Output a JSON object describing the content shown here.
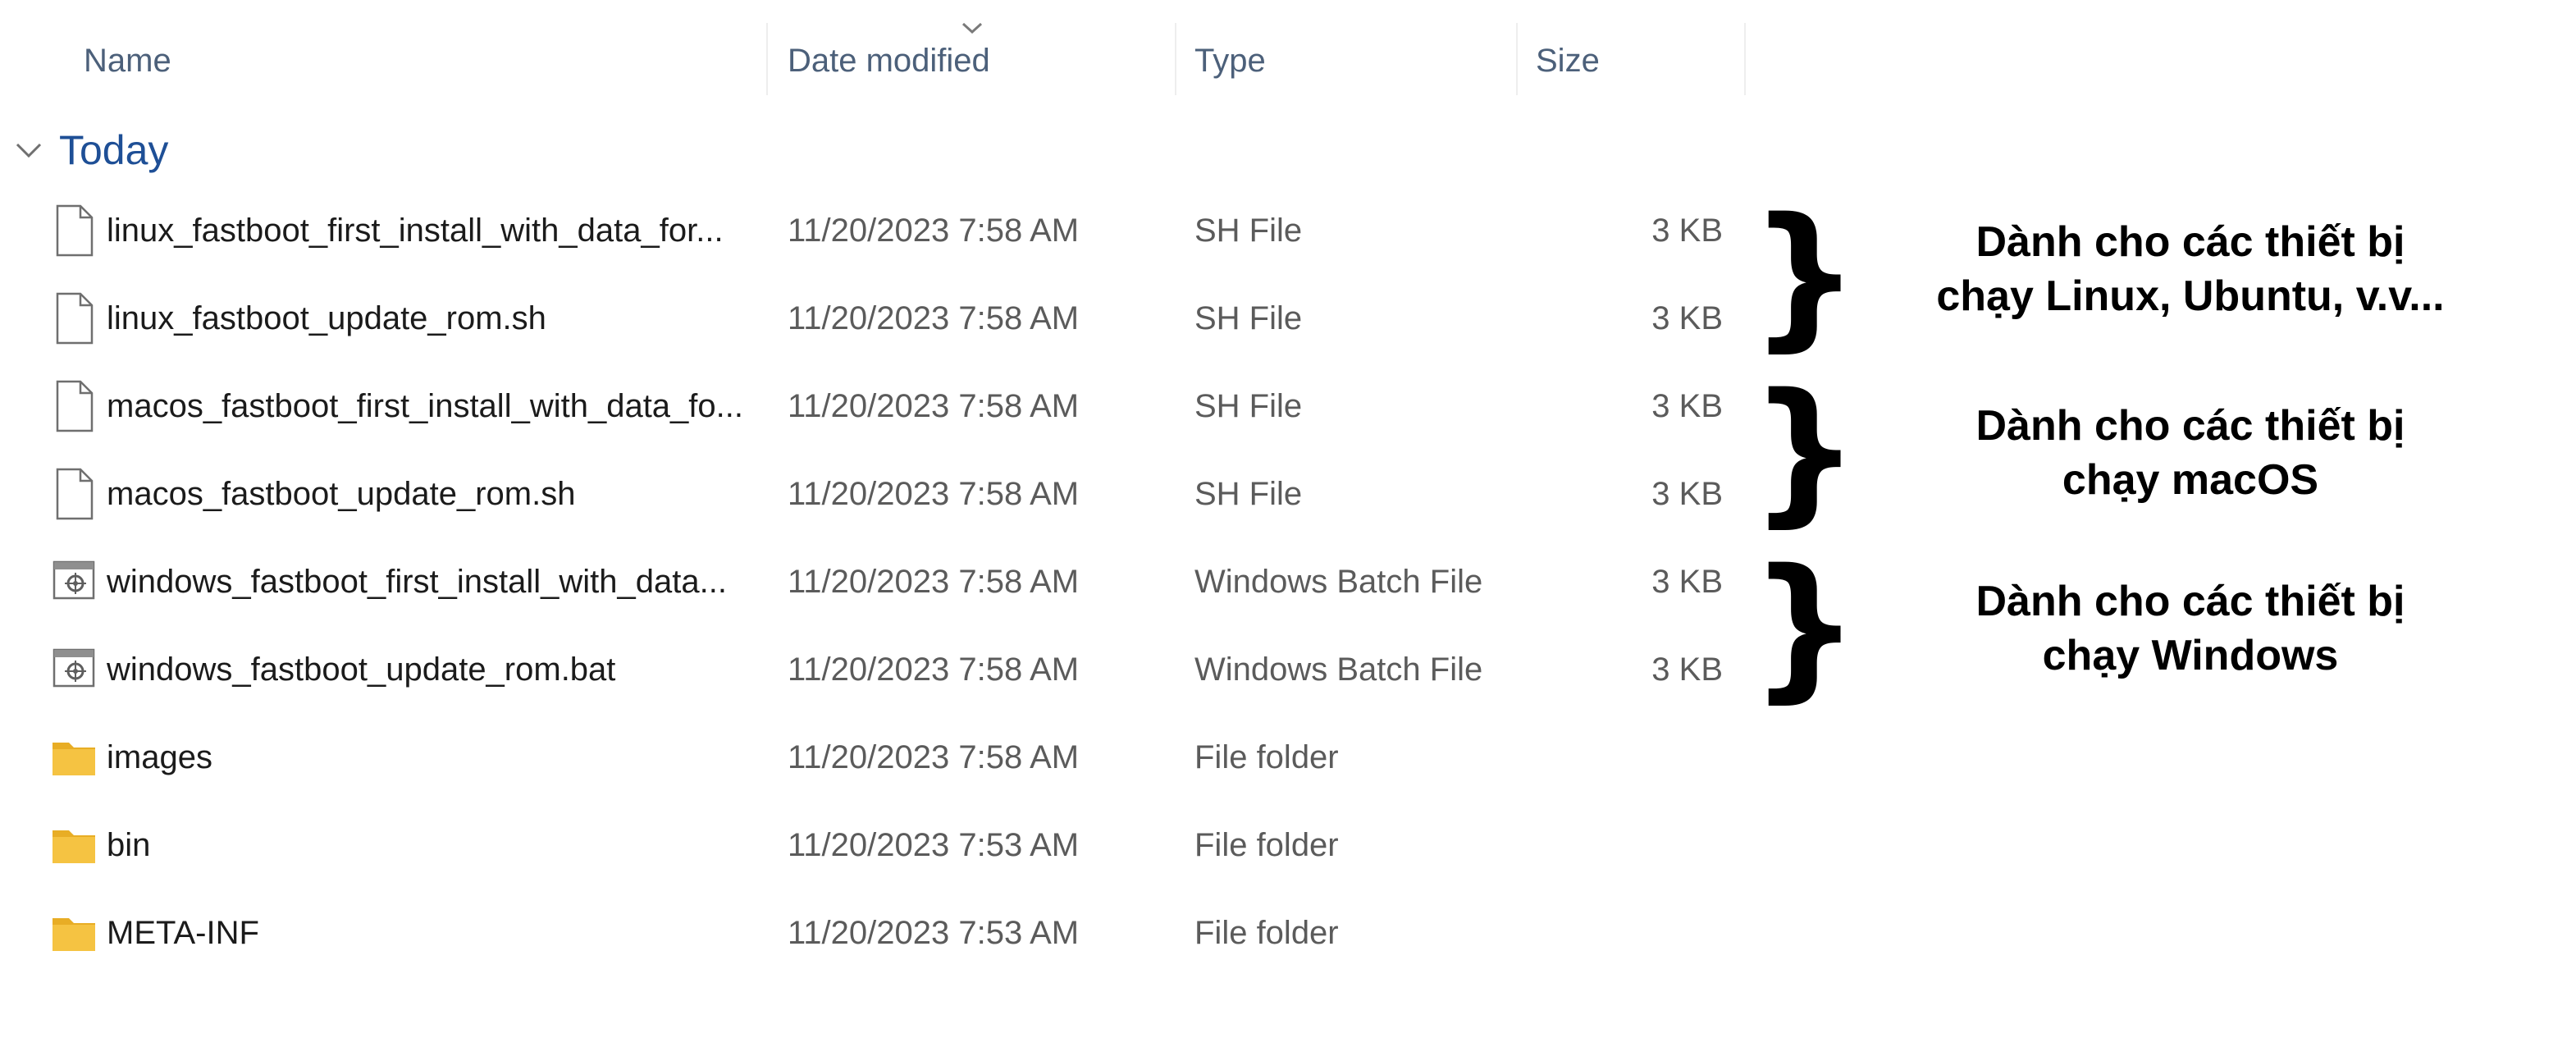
{
  "columns": {
    "name": "Name",
    "date_modified": "Date modified",
    "type": "Type",
    "size": "Size"
  },
  "sort": {
    "column": "date_modified",
    "direction": "descending",
    "icon": "chevron-down-icon"
  },
  "group": {
    "title": "Today",
    "expanded": true
  },
  "files": [
    {
      "name": "linux_fastboot_first_install_with_data_for...",
      "date": "11/20/2023 7:58 AM",
      "type": "SH File",
      "size": "3 KB",
      "icon": "document-icon"
    },
    {
      "name": "linux_fastboot_update_rom.sh",
      "date": "11/20/2023 7:58 AM",
      "type": "SH File",
      "size": "3 KB",
      "icon": "document-icon"
    },
    {
      "name": "macos_fastboot_first_install_with_data_fo...",
      "date": "11/20/2023 7:58 AM",
      "type": "SH File",
      "size": "3 KB",
      "icon": "document-icon"
    },
    {
      "name": "macos_fastboot_update_rom.sh",
      "date": "11/20/2023 7:58 AM",
      "type": "SH File",
      "size": "3 KB",
      "icon": "document-icon"
    },
    {
      "name": "windows_fastboot_first_install_with_data...",
      "date": "11/20/2023 7:58 AM",
      "type": "Windows Batch File",
      "size": "3 KB",
      "icon": "batch-file-icon"
    },
    {
      "name": "windows_fastboot_update_rom.bat",
      "date": "11/20/2023 7:58 AM",
      "type": "Windows Batch File",
      "size": "3 KB",
      "icon": "batch-file-icon"
    },
    {
      "name": "images",
      "date": "11/20/2023 7:58 AM",
      "type": "File folder",
      "size": "",
      "icon": "folder-icon"
    },
    {
      "name": "bin",
      "date": "11/20/2023 7:53 AM",
      "type": "File folder",
      "size": "",
      "icon": "folder-icon"
    },
    {
      "name": "META-INF",
      "date": "11/20/2023 7:53 AM",
      "type": "File folder",
      "size": "",
      "icon": "folder-icon"
    }
  ],
  "annotations": [
    {
      "brace": "}",
      "line1": "Dành cho các thiết bị",
      "line2": "chạy Linux, Ubuntu, v.v..."
    },
    {
      "brace": "}",
      "line1": "Dành cho các thiết bị",
      "line2": "chạy macOS"
    },
    {
      "brace": "}",
      "line1": "Dành cho các thiết bị",
      "line2": "chạy Windows"
    }
  ],
  "colors": {
    "header_text": "#4c607a",
    "group_title": "#1e4f96",
    "folder": "#f5c342",
    "text_primary": "#1b1b1b",
    "text_secondary": "#5b5b5b"
  }
}
